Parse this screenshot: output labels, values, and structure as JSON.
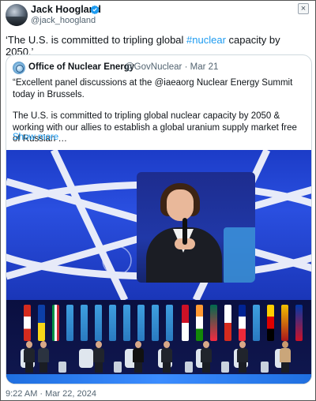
{
  "author": {
    "name": "Jack Hoogland",
    "handle": "@jack_hoogland",
    "verified": true,
    "avatar_icon": "avatar-photo"
  },
  "tweet": {
    "text_before": "‘The U.S. is committed to tripling global ",
    "hashtag": "#nuclear",
    "text_after": " capacity by 2050.’",
    "timestamp": "9:22 AM · Mar 22, 2024"
  },
  "close_icon": "close-icon",
  "close_label": "×",
  "quoted": {
    "name": "Office of Nuclear Energy",
    "handle_date": "@GovNuclear · Mar 21",
    "para1": "“Excellent panel discussions at the @iaeaorg Nuclear Energy Summit today in Brussels.",
    "para2": "The U.S. is committed to tripling global nuclear capacity by 2050 & working with our allies to establish a global uranium supply market free of Russian …",
    "show_more": "Show more"
  },
  "colors": {
    "link": "#1d9bf0",
    "verified": "#1d9bf0",
    "secondary_text": "#536471"
  }
}
